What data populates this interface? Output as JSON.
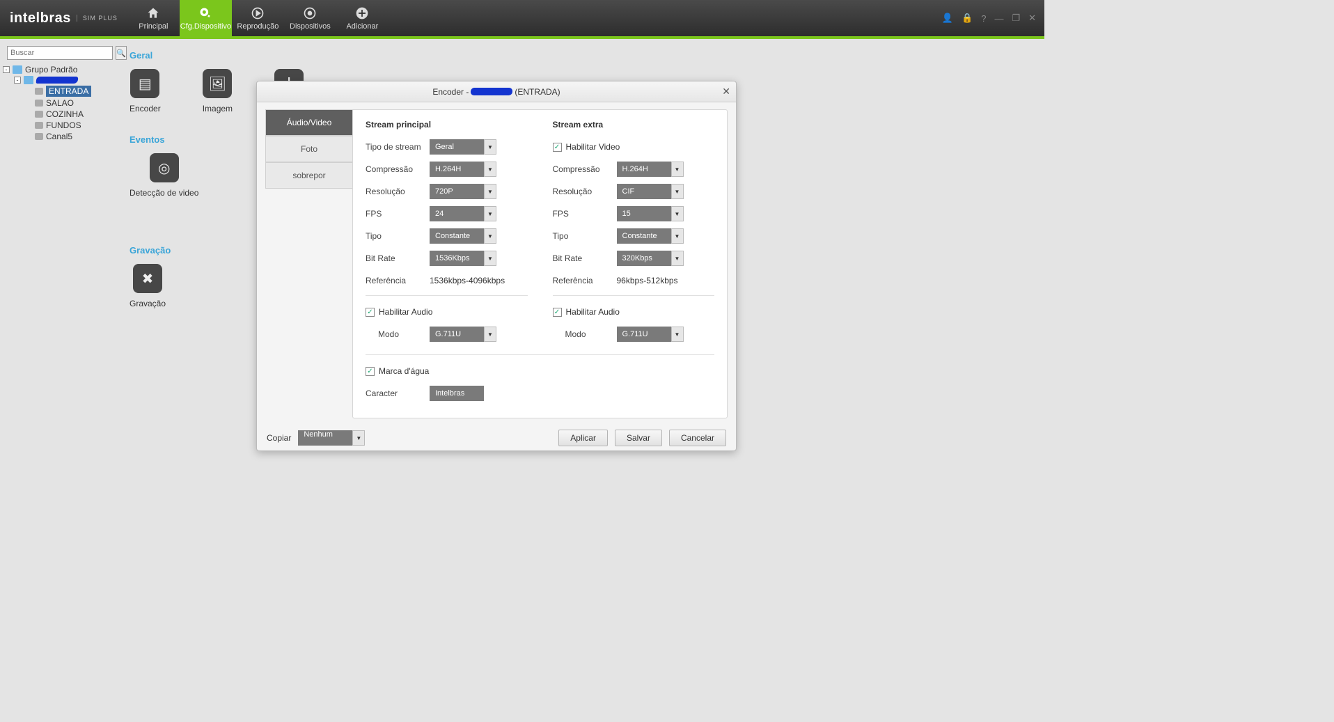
{
  "brand": {
    "name": "intelbras",
    "sub": "SIM PLUS"
  },
  "nav": {
    "principal": "Principal",
    "cfg": "Cfg.Dispositivo",
    "reproducao": "Reprodução",
    "dispositivos": "Dispositivos",
    "adicionar": "Adicionar"
  },
  "sidebar": {
    "search_placeholder": "Buscar",
    "group": "Grupo Padrão",
    "channels": {
      "entrada": "ENTRADA",
      "salao": "SALAO",
      "cozinha": "COZINHA",
      "fundos": "FUNDOS",
      "canal5": "Canal5"
    }
  },
  "sections": {
    "geral": "Geral",
    "eventos": "Eventos",
    "gravacao": "Gravação"
  },
  "tiles": {
    "encoder": "Encoder",
    "imagem": "Imagem",
    "deteccao": "Detecção de video",
    "gravacao": "Gravação"
  },
  "dialog": {
    "title_prefix": "Encoder  -  ",
    "title_suffix": "(ENTRADA)",
    "tabs": {
      "av": "Áudio/Video",
      "foto": "Foto",
      "sobrepor": "sobrepor"
    },
    "main": {
      "heading": "Stream principal",
      "tipo_stream_lbl": "Tipo de stream",
      "tipo_stream_val": "Geral",
      "compressao_lbl": "Compressão",
      "compressao_val": "H.264H",
      "resolucao_lbl": "Resolução",
      "resolucao_val": "720P",
      "fps_lbl": "FPS",
      "fps_val": "24",
      "tipo_lbl": "Tipo",
      "tipo_val": "Constante",
      "bitrate_lbl": "Bit  Rate",
      "bitrate_val": "1536Kbps",
      "ref_lbl": "Referência",
      "ref_val": "1536kbps-4096kbps",
      "hab_audio": "Habilitar Audio",
      "modo_lbl": "Modo",
      "modo_val": "G.711U"
    },
    "extra": {
      "heading": "Stream extra",
      "hab_video": "Habilitar Video",
      "compressao_lbl": "Compressão",
      "compressao_val": "H.264H",
      "resolucao_lbl": "Resolução",
      "resolucao_val": "CIF",
      "fps_lbl": "FPS",
      "fps_val": "15",
      "tipo_lbl": "Tipo",
      "tipo_val": "Constante",
      "bitrate_lbl": "Bit  Rate",
      "bitrate_val": "320Kbps",
      "ref_lbl": "Referência",
      "ref_val": "96kbps-512kbps",
      "hab_audio": "Habilitar Audio",
      "modo_lbl": "Modo",
      "modo_val": "G.711U"
    },
    "marca_lbl": "Marca d'água",
    "caracter_lbl": "Caracter",
    "caracter_val": "Intelbras",
    "footer": {
      "copiar": "Copiar",
      "copiar_val": "Nenhum",
      "aplicar": "Aplicar",
      "salvar": "Salvar",
      "cancelar": "Cancelar"
    }
  }
}
